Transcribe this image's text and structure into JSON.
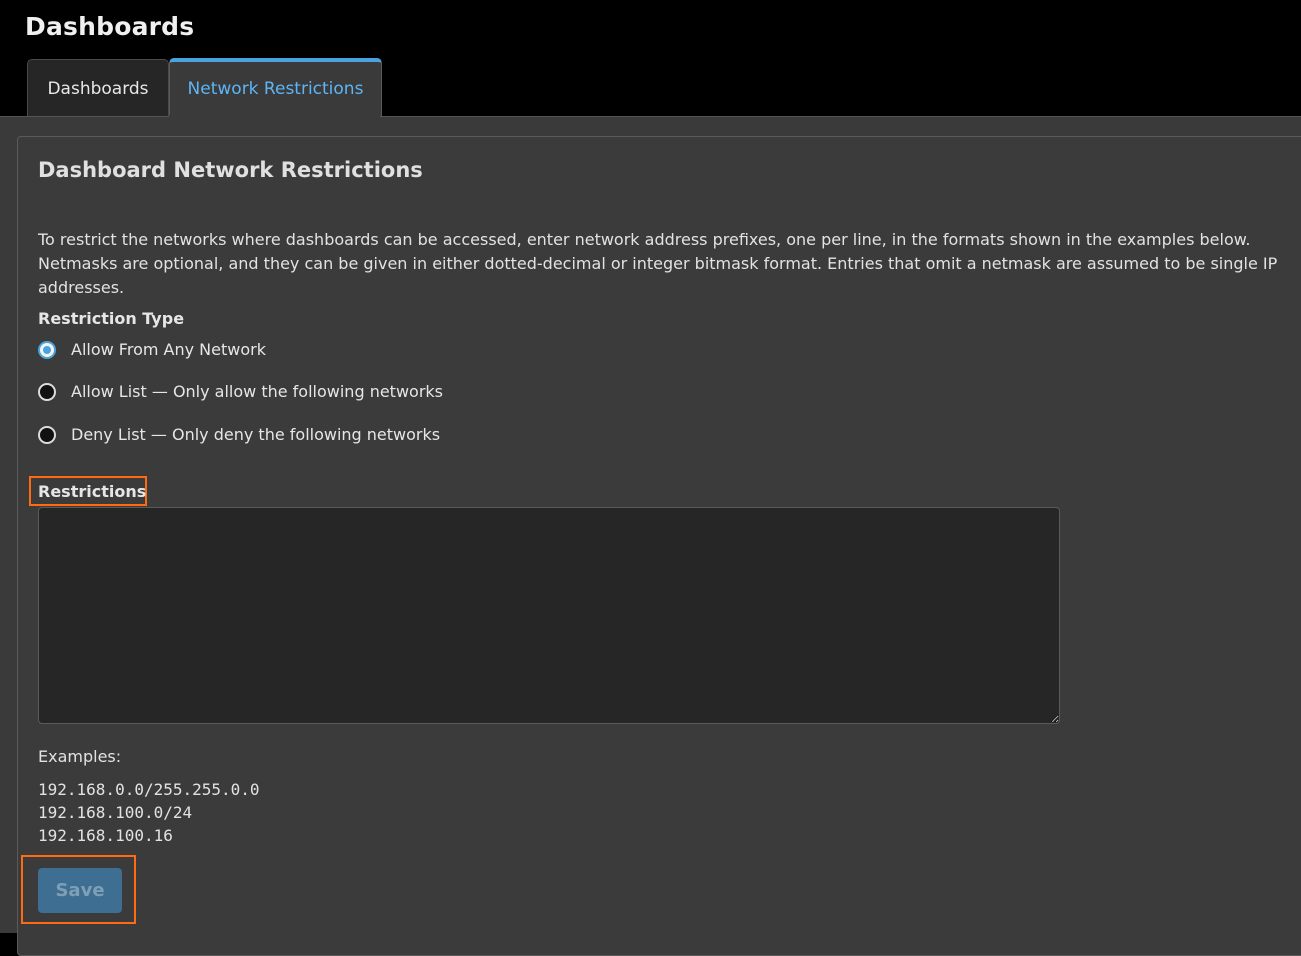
{
  "app": {
    "title": "Dashboards"
  },
  "tabs": [
    {
      "label": "Dashboards",
      "active": false
    },
    {
      "label": "Network Restrictions",
      "active": true
    }
  ],
  "panel": {
    "title": "Dashboard Network Restrictions",
    "description": "To restrict the networks where dashboards can be accessed, enter network address prefixes, one per line, in the formats shown in the examples below. Netmasks are optional, and they can be given in either dotted-decimal or integer bitmask format. Entries that omit a netmask are assumed to be single IP addresses.",
    "restriction_type": {
      "label": "Restriction Type",
      "options": [
        {
          "label": "Allow From Any Network",
          "checked": true
        },
        {
          "label": "Allow List — Only allow the following networks",
          "checked": false
        },
        {
          "label": "Deny List — Only deny the following networks",
          "checked": false
        }
      ]
    },
    "restrictions": {
      "label": "Restrictions",
      "value": ""
    },
    "examples": {
      "label": "Examples:",
      "items": [
        "192.168.0.0/255.255.0.0",
        "192.168.100.0/24",
        "192.168.100.16"
      ]
    },
    "save_label": "Save"
  },
  "colors": {
    "accent": "#4aa3df",
    "highlight_box": "#ff6a13",
    "save_button": "#3e6f92"
  }
}
